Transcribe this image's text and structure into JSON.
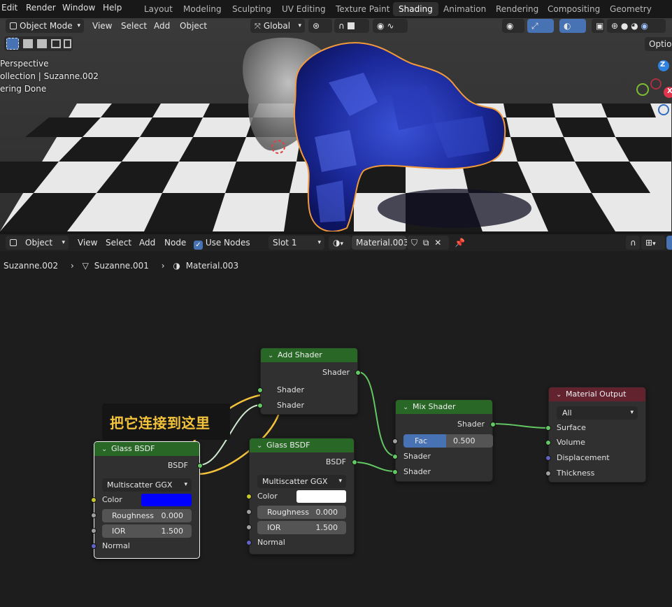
{
  "menus": [
    "Edit",
    "Render",
    "Window",
    "Help"
  ],
  "workspaces": [
    "Layout",
    "Modeling",
    "Sculpting",
    "UV Editing",
    "Texture Paint",
    "Shading",
    "Animation",
    "Rendering",
    "Compositing",
    "Geometry Nodes"
  ],
  "active_workspace": "Shading",
  "viewport": {
    "mode": "Object Mode",
    "menu": [
      "View",
      "Select",
      "Add",
      "Object"
    ],
    "orientation": "Global",
    "options_label": "Optio",
    "overlay": [
      "Perspective",
      "ollection | Suzanne.002",
      "ering Done"
    ],
    "gizmo": {
      "z": "Z",
      "x": "X"
    }
  },
  "node_editor": {
    "type_dropdown": "Object",
    "menu": [
      "View",
      "Select",
      "Add",
      "Node"
    ],
    "use_nodes_label": "Use Nodes",
    "use_nodes_checked": true,
    "slot": "Slot 1",
    "material": "Material.003",
    "breadcrumb": [
      "Suzanne.002",
      "Suzanne.001",
      "Material.003"
    ]
  },
  "nodes": {
    "add_shader": {
      "title": "Add Shader",
      "output": "Shader",
      "inputs": [
        "Shader",
        "Shader"
      ]
    },
    "mix_shader": {
      "title": "Mix Shader",
      "output": "Shader",
      "fac_label": "Fac",
      "fac_value": "0.500",
      "inputs": [
        "Shader",
        "Shader"
      ]
    },
    "material_output": {
      "title": "Material Output",
      "target": "All",
      "inputs": [
        "Surface",
        "Volume",
        "Displacement",
        "Thickness"
      ]
    },
    "glass_left": {
      "title": "Glass BSDF",
      "output": "BSDF",
      "distribution": "Multiscatter GGX",
      "color_label": "Color",
      "color": "#0000ff",
      "roughness_label": "Roughness",
      "roughness": "0.000",
      "ior_label": "IOR",
      "ior": "1.500",
      "normal_label": "Normal"
    },
    "glass_right": {
      "title": "Glass BSDF",
      "output": "BSDF",
      "distribution": "Multiscatter GGX",
      "color_label": "Color",
      "color": "#ffffff",
      "roughness_label": "Roughness",
      "roughness": "0.000",
      "ior_label": "IOR",
      "ior": "1.500",
      "normal_label": "Normal"
    }
  },
  "annotation": "把它连接到这里",
  "colors": {
    "node_header": "#286726",
    "output_header": "#62222e",
    "link": "#63c763",
    "annotation": "#f3c33b",
    "accent": "#4772b3",
    "selection": "#f29a3b"
  }
}
